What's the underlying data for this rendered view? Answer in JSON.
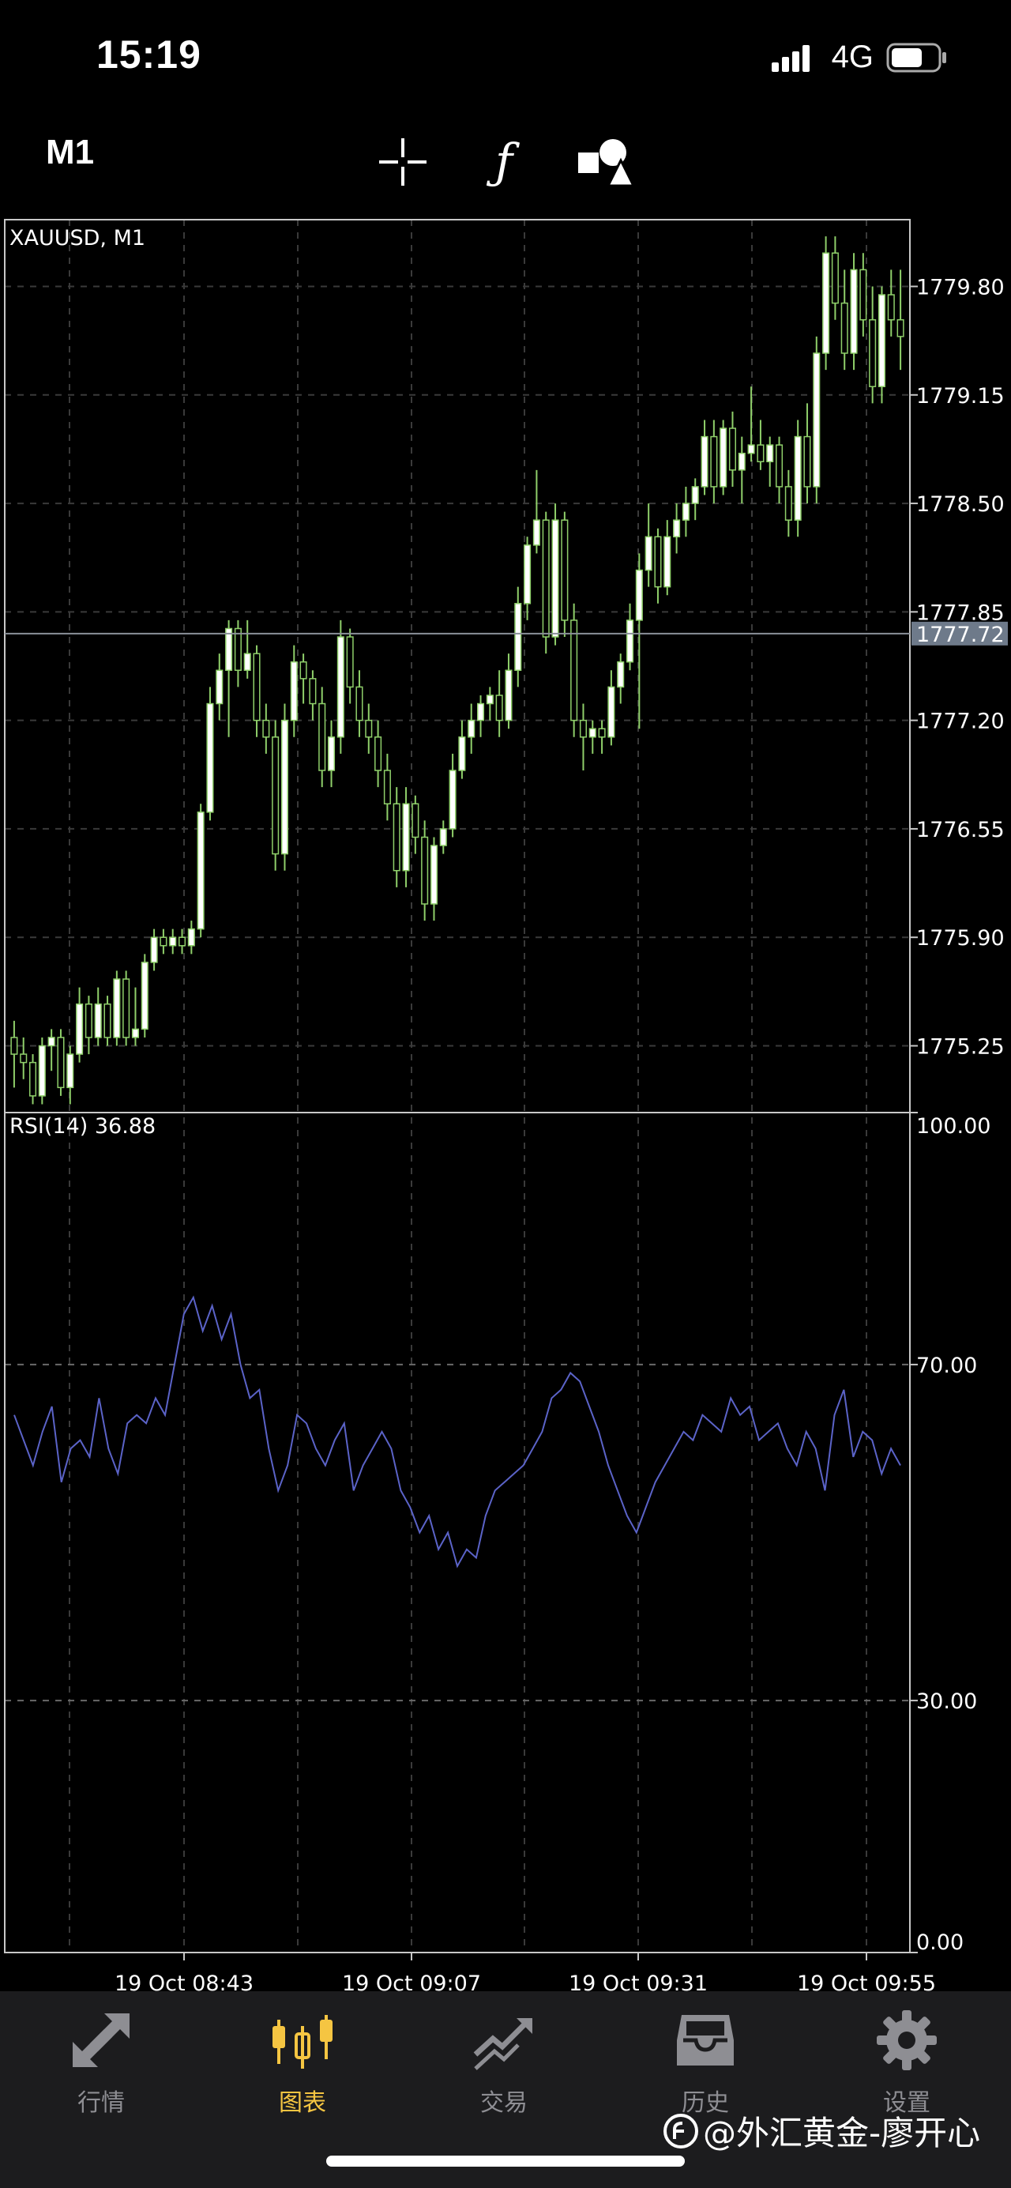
{
  "status_bar": {
    "time": "15:19",
    "network": "4G"
  },
  "toolbar": {
    "timeframe": "M1",
    "tools": [
      {
        "icon": "crosshair-icon"
      },
      {
        "icon": "function-icon",
        "glyph": "ƒ"
      },
      {
        "icon": "objects-icon"
      }
    ]
  },
  "chart_data": [
    {
      "type": "candlestick",
      "title": "XAUUSD, M1",
      "ylim": [
        1774.85,
        1780.2
      ],
      "y_ticks": [
        "1779.80",
        "1779.15",
        "1778.50",
        "1777.85",
        "1777.20",
        "1776.55",
        "1775.90",
        "1775.25"
      ],
      "current_price": "1777.72",
      "grid": true,
      "up_color": "#ffffff",
      "down_color": "#000000",
      "wick_color": "#8fcf6a",
      "candles": [
        [
          1775.3,
          1775.4,
          1775.0,
          1775.2
        ],
        [
          1775.2,
          1775.3,
          1775.05,
          1775.15
        ],
        [
          1775.15,
          1775.2,
          1774.9,
          1774.95
        ],
        [
          1774.95,
          1775.3,
          1774.9,
          1775.25
        ],
        [
          1775.25,
          1775.35,
          1775.1,
          1775.3
        ],
        [
          1775.3,
          1775.35,
          1774.95,
          1775.0
        ],
        [
          1775.0,
          1775.25,
          1774.9,
          1775.2
        ],
        [
          1775.2,
          1775.6,
          1775.15,
          1775.5
        ],
        [
          1775.5,
          1775.55,
          1775.2,
          1775.3
        ],
        [
          1775.3,
          1775.6,
          1775.25,
          1775.5
        ],
        [
          1775.5,
          1775.55,
          1775.25,
          1775.3
        ],
        [
          1775.3,
          1775.7,
          1775.25,
          1775.65
        ],
        [
          1775.65,
          1775.7,
          1775.25,
          1775.3
        ],
        [
          1775.3,
          1775.6,
          1775.25,
          1775.35
        ],
        [
          1775.35,
          1775.8,
          1775.3,
          1775.75
        ],
        [
          1775.75,
          1775.95,
          1775.7,
          1775.9
        ],
        [
          1775.9,
          1775.95,
          1775.8,
          1775.85
        ],
        [
          1775.85,
          1775.95,
          1775.8,
          1775.9
        ],
        [
          1775.9,
          1775.95,
          1775.8,
          1775.85
        ],
        [
          1775.85,
          1776.0,
          1775.8,
          1775.95
        ],
        [
          1775.95,
          1776.7,
          1775.9,
          1776.65
        ],
        [
          1776.65,
          1777.4,
          1776.6,
          1777.3
        ],
        [
          1777.3,
          1777.6,
          1777.2,
          1777.5
        ],
        [
          1777.5,
          1777.8,
          1777.1,
          1777.75
        ],
        [
          1777.75,
          1777.8,
          1777.4,
          1777.5
        ],
        [
          1777.5,
          1777.8,
          1777.45,
          1777.6
        ],
        [
          1777.6,
          1777.65,
          1777.1,
          1777.2
        ],
        [
          1777.2,
          1777.3,
          1777.0,
          1777.1
        ],
        [
          1777.1,
          1777.2,
          1776.3,
          1776.4
        ],
        [
          1776.4,
          1777.3,
          1776.3,
          1777.2
        ],
        [
          1777.2,
          1777.65,
          1777.1,
          1777.55
        ],
        [
          1777.55,
          1777.6,
          1777.3,
          1777.45
        ],
        [
          1777.45,
          1777.5,
          1777.2,
          1777.3
        ],
        [
          1777.3,
          1777.4,
          1776.8,
          1776.9
        ],
        [
          1776.9,
          1777.2,
          1776.8,
          1777.1
        ],
        [
          1777.1,
          1777.8,
          1777.0,
          1777.7
        ],
        [
          1777.7,
          1777.75,
          1777.3,
          1777.4
        ],
        [
          1777.4,
          1777.5,
          1777.1,
          1777.2
        ],
        [
          1777.2,
          1777.3,
          1777.0,
          1777.1
        ],
        [
          1777.1,
          1777.2,
          1776.8,
          1776.9
        ],
        [
          1776.9,
          1777.0,
          1776.6,
          1776.7
        ],
        [
          1776.7,
          1776.8,
          1776.2,
          1776.3
        ],
        [
          1776.3,
          1776.8,
          1776.2,
          1776.7
        ],
        [
          1776.7,
          1776.75,
          1776.4,
          1776.5
        ],
        [
          1776.5,
          1776.6,
          1776.0,
          1776.1
        ],
        [
          1776.1,
          1776.5,
          1776.0,
          1776.45
        ],
        [
          1776.45,
          1776.6,
          1776.4,
          1776.55
        ],
        [
          1776.55,
          1777.0,
          1776.5,
          1776.9
        ],
        [
          1776.9,
          1777.2,
          1776.85,
          1777.1
        ],
        [
          1777.1,
          1777.3,
          1777.0,
          1777.2
        ],
        [
          1777.2,
          1777.35,
          1777.1,
          1777.3
        ],
        [
          1777.3,
          1777.4,
          1777.2,
          1777.35
        ],
        [
          1777.35,
          1777.5,
          1777.1,
          1777.2
        ],
        [
          1777.2,
          1777.6,
          1777.15,
          1777.5
        ],
        [
          1777.5,
          1778.0,
          1777.4,
          1777.9
        ],
        [
          1777.9,
          1778.3,
          1777.8,
          1778.25
        ],
        [
          1778.25,
          1778.7,
          1778.2,
          1778.4
        ],
        [
          1778.4,
          1778.45,
          1777.6,
          1777.7
        ],
        [
          1777.7,
          1778.5,
          1777.65,
          1778.4
        ],
        [
          1778.4,
          1778.45,
          1777.7,
          1777.8
        ],
        [
          1777.8,
          1777.9,
          1777.1,
          1777.2
        ],
        [
          1777.2,
          1777.3,
          1776.9,
          1777.1
        ],
        [
          1777.1,
          1777.2,
          1777.0,
          1777.15
        ],
        [
          1777.15,
          1777.2,
          1777.0,
          1777.1
        ],
        [
          1777.1,
          1777.5,
          1777.05,
          1777.4
        ],
        [
          1777.4,
          1777.6,
          1777.3,
          1777.55
        ],
        [
          1777.55,
          1777.9,
          1777.5,
          1777.8
        ],
        [
          1777.8,
          1778.2,
          1777.15,
          1778.1
        ],
        [
          1778.1,
          1778.5,
          1778.0,
          1778.3
        ],
        [
          1778.3,
          1778.35,
          1777.9,
          1778.0
        ],
        [
          1778.0,
          1778.4,
          1777.95,
          1778.3
        ],
        [
          1778.3,
          1778.5,
          1778.2,
          1778.4
        ],
        [
          1778.4,
          1778.6,
          1778.3,
          1778.5
        ],
        [
          1778.5,
          1778.65,
          1778.4,
          1778.6
        ],
        [
          1778.6,
          1779.0,
          1778.55,
          1778.9
        ],
        [
          1778.9,
          1779.0,
          1778.5,
          1778.6
        ],
        [
          1778.6,
          1779.0,
          1778.55,
          1778.95
        ],
        [
          1778.95,
          1779.05,
          1778.6,
          1778.7
        ],
        [
          1778.7,
          1778.9,
          1778.5,
          1778.8
        ],
        [
          1778.8,
          1779.2,
          1778.75,
          1778.85
        ],
        [
          1778.85,
          1779.0,
          1778.7,
          1778.75
        ],
        [
          1778.75,
          1778.9,
          1778.6,
          1778.85
        ],
        [
          1778.85,
          1778.9,
          1778.5,
          1778.6
        ],
        [
          1778.6,
          1778.7,
          1778.3,
          1778.4
        ],
        [
          1778.4,
          1779.0,
          1778.3,
          1778.9
        ],
        [
          1778.9,
          1779.1,
          1778.5,
          1778.6
        ],
        [
          1778.6,
          1779.5,
          1778.5,
          1779.4
        ],
        [
          1779.4,
          1780.1,
          1779.3,
          1780.0
        ],
        [
          1780.0,
          1780.1,
          1779.6,
          1779.7
        ],
        [
          1779.7,
          1779.9,
          1779.3,
          1779.4
        ],
        [
          1779.4,
          1780.0,
          1779.3,
          1779.9
        ],
        [
          1779.9,
          1780.0,
          1779.5,
          1779.6
        ],
        [
          1779.6,
          1779.8,
          1779.1,
          1779.2
        ],
        [
          1779.2,
          1779.8,
          1779.1,
          1779.75
        ],
        [
          1779.75,
          1779.9,
          1779.5,
          1779.6
        ],
        [
          1779.6,
          1779.9,
          1779.3,
          1779.5
        ]
      ]
    },
    {
      "type": "line",
      "title": "RSI(14) 36.88",
      "ylim": [
        0,
        100
      ],
      "y_ticks": [
        "100.00",
        "70.00",
        "30.00",
        "0.00"
      ],
      "levels": [
        70,
        30
      ],
      "x_ticks": [
        "19 Oct 08:43",
        "19 Oct 09:07",
        "19 Oct 09:31",
        "19 Oct 09:55"
      ],
      "line_color": "#5b63c8",
      "values": [
        64,
        61,
        58,
        62,
        65,
        56,
        60,
        61,
        59,
        66,
        60,
        57,
        63,
        64,
        63,
        66,
        64,
        70,
        76,
        78,
        74,
        77,
        73,
        76,
        70,
        66,
        67,
        60,
        55,
        58,
        64,
        63,
        60,
        58,
        61,
        63,
        55,
        58,
        60,
        62,
        60,
        55,
        53,
        50,
        52,
        48,
        50,
        46,
        48,
        47,
        52,
        55,
        56,
        57,
        58,
        60,
        62,
        66,
        67,
        69,
        68,
        65,
        62,
        58,
        55,
        52,
        50,
        53,
        56,
        58,
        60,
        62,
        61,
        64,
        63,
        62,
        66,
        64,
        65,
        61,
        62,
        63,
        60,
        58,
        62,
        60,
        55,
        64,
        67,
        59,
        62,
        61,
        57,
        60,
        58
      ]
    }
  ],
  "tabs": [
    {
      "label": "行情",
      "icon": "quotes-icon"
    },
    {
      "label": "图表",
      "icon": "chart-icon",
      "active": true
    },
    {
      "label": "交易",
      "icon": "trade-icon"
    },
    {
      "label": "历史",
      "icon": "history-icon"
    },
    {
      "label": "设置",
      "icon": "settings-icon"
    }
  ],
  "watermark": {
    "text": "@外汇黄金-廖开心"
  },
  "colors": {
    "active_tab": "#f5c542",
    "inactive_tab": "#8e8e93",
    "current_price_bg": "#6e7a8a"
  }
}
